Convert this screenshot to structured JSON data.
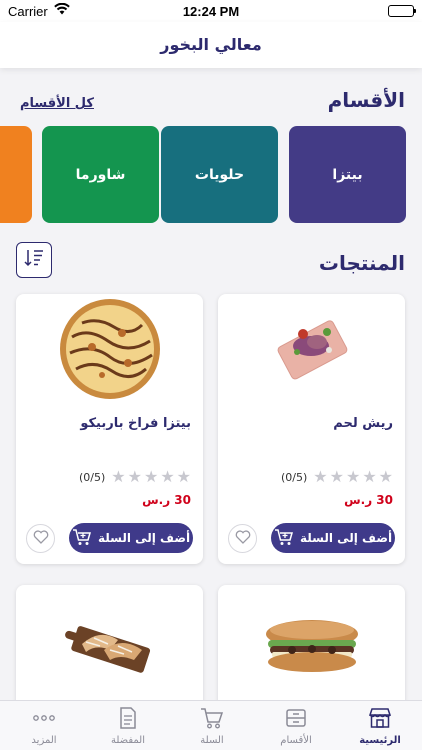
{
  "status": {
    "carrier": "Carrier",
    "time": "12:24 PM"
  },
  "header": {
    "title": "معالي البخور"
  },
  "categories": {
    "title": "الأقسام",
    "all_link": "كل الأقسام",
    "items": [
      {
        "label": "بيتزا",
        "color": "#433b86"
      },
      {
        "label": "حلويات",
        "color": "#176f7e"
      },
      {
        "label": "شاورما",
        "color": "#14954f"
      },
      {
        "label": "",
        "color": "#f0811f"
      }
    ]
  },
  "products": {
    "title": "المنتجات",
    "items": [
      {
        "name": "ريش لحم",
        "rating": "(0/5)",
        "stars": 0,
        "price": "30 ر.س",
        "add_label": "أضف إلى السلة",
        "image": "meat-ribs-image"
      },
      {
        "name": "بيتزا فراخ باربيكو",
        "rating": "(0/5)",
        "stars": 0,
        "price": "30 ر.س",
        "add_label": "أضف إلى السلة",
        "image": "bbq-chicken-pizza-image"
      },
      {
        "name": "",
        "rating": "",
        "price": "",
        "add_label": "",
        "image": "sandwich-image"
      },
      {
        "name": "",
        "rating": "",
        "price": "",
        "add_label": "",
        "image": "pastry-board-image"
      }
    ]
  },
  "tabbar": {
    "items": [
      {
        "label": "الرئيسية",
        "icon": "store-icon",
        "active": true
      },
      {
        "label": "الأقسام",
        "icon": "box-icon",
        "active": false
      },
      {
        "label": "السلة",
        "icon": "cart-icon",
        "active": false
      },
      {
        "label": "المفضلة",
        "icon": "document-icon",
        "active": false
      },
      {
        "label": "المزيد",
        "icon": "more-icon",
        "active": false
      }
    ]
  },
  "colors": {
    "primary": "#3f3a8a",
    "price": "#d0021b",
    "title": "#2d2a6e"
  }
}
